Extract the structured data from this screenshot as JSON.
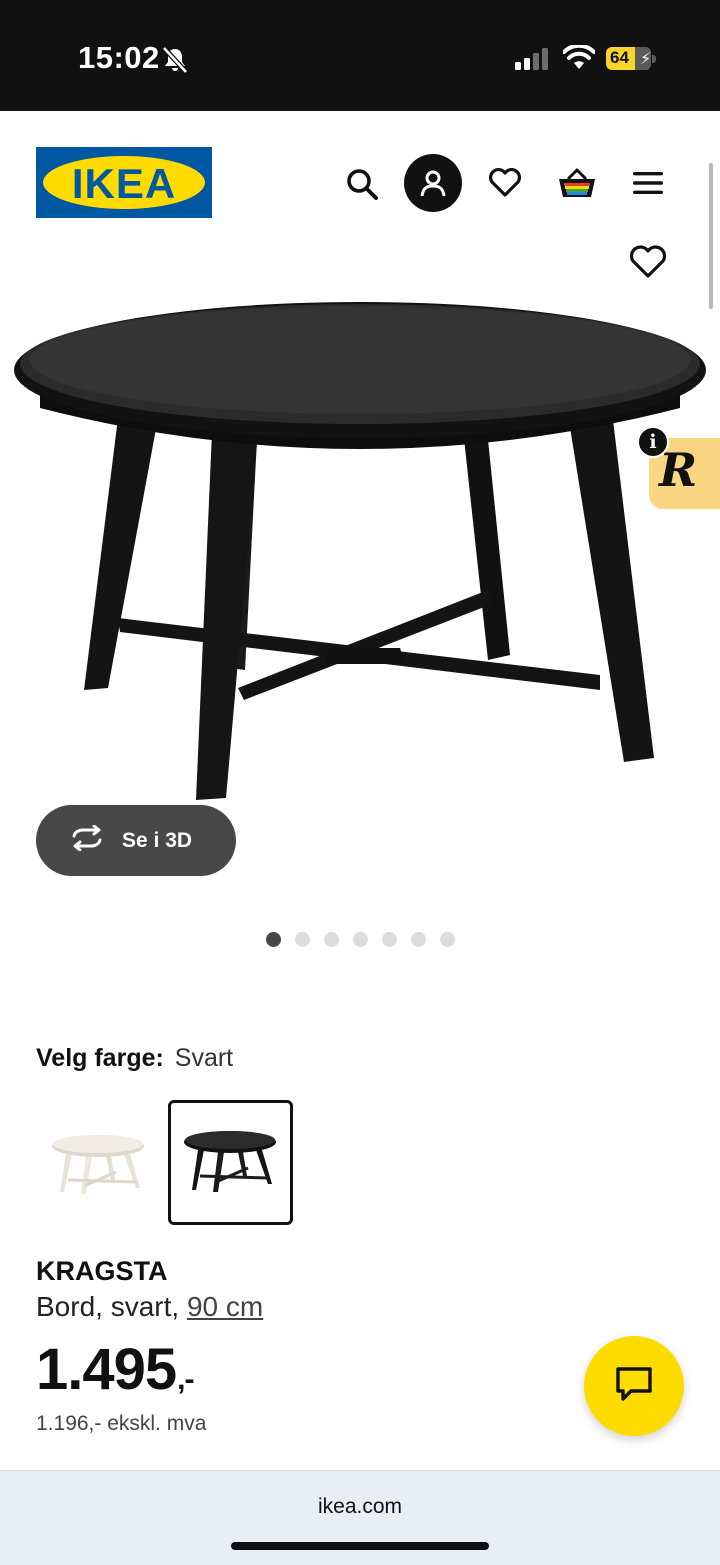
{
  "status_bar": {
    "time": "15:02",
    "battery": "64",
    "battery_level": 0.64,
    "icons": [
      "bell-slash-icon",
      "signal-icon",
      "wifi-icon",
      "battery-charging-icon"
    ]
  },
  "header": {
    "logo_text": "IKEA",
    "brand_colors": {
      "blue": "#0058a3",
      "yellow": "#ffdb00"
    },
    "icons": [
      "search-icon",
      "account-icon",
      "heart-icon",
      "cart-icon",
      "menu-icon"
    ]
  },
  "gallery": {
    "view_3d_label": "Se i 3D",
    "dot_count": 7,
    "active_dot": 0
  },
  "recommendation_badge": {
    "letter": "R",
    "info": "i"
  },
  "product": {
    "color_label": "Velg farge:",
    "color_value": "Svart",
    "color_options": [
      "white",
      "black"
    ],
    "selected_color": "black",
    "name": "KRAGSTA",
    "desc_prefix": "Bord, svart, ",
    "size_link": "90 cm",
    "price": "1.495",
    "price_suffix": ",-",
    "price_ex_vat": "1.196,- ekskl. mva"
  },
  "browser": {
    "url": "ikea.com"
  }
}
